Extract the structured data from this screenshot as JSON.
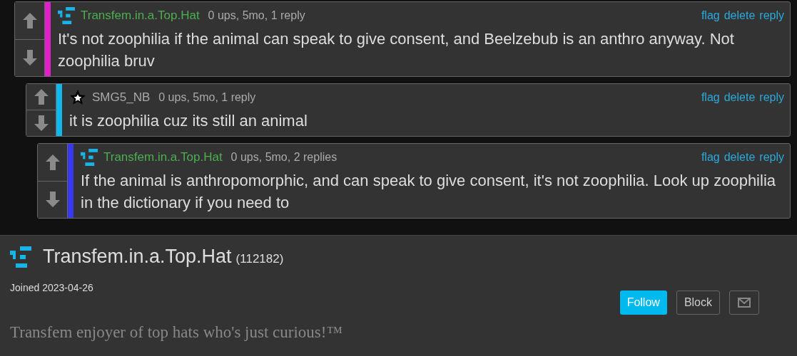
{
  "comments": [
    {
      "author": {
        "name": "Transfem.in.a.Top.Hat",
        "kind": "logo",
        "color": "#4caf50"
      },
      "meta": "0 ups, 5mo, 1 reply",
      "color": "#e020c8",
      "actions": [
        "flag",
        "delete",
        "reply"
      ],
      "text": "It's not zoophilia if the animal can speak to give consent, and Beelzebub is an anthro anyway. Not zoophilia bruv",
      "children": [
        {
          "author": {
            "name": "SMG5_NB",
            "kind": "star",
            "color": "#aaaaaa"
          },
          "meta": "0 ups, 5mo, 1 reply",
          "color": "#12b8ec",
          "actions": [
            "flag",
            "delete",
            "reply"
          ],
          "text": "it is zoophilia cuz its still an animal",
          "children": [
            {
              "author": {
                "name": "Transfem.in.a.Top.Hat",
                "kind": "logo",
                "color": "#4caf50"
              },
              "meta": "0 ups, 5mo, 2 replies",
              "color": "#3838f0",
              "actions": [
                "flag",
                "delete",
                "reply"
              ],
              "text": "If the animal is anthropomorphic, and can speak to give consent, it's not zoophilia. Look up zoophilia in the dictionary if you need to"
            }
          ]
        }
      ]
    }
  ],
  "profile": {
    "name": "Transfem.in.a.Top.Hat",
    "points": "(112182)",
    "joined": "Joined 2023-04-26",
    "buttons": [
      {
        "label": "Follow",
        "kind": "primary"
      },
      {
        "label": "Block",
        "kind": "outline"
      },
      {
        "kind": "mail"
      }
    ],
    "bio": "Transfem enjoyer of top hats who's just curious!™"
  }
}
